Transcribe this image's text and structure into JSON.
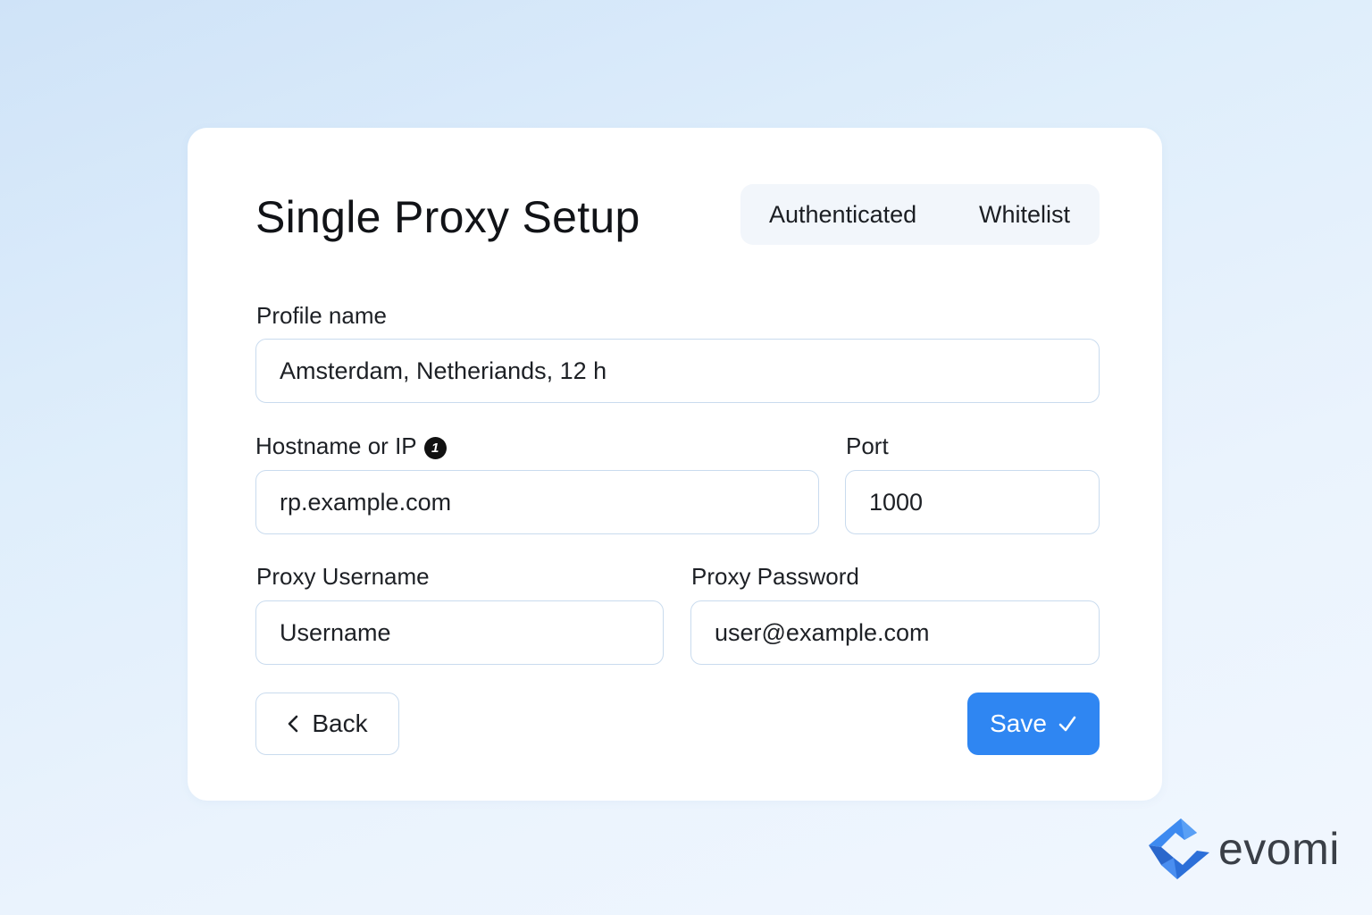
{
  "card": {
    "title": "Single Proxy Setup",
    "toggle": {
      "options": [
        "Authenticated",
        "Whitelist"
      ]
    },
    "fields": {
      "profile_name": {
        "label": "Profile name",
        "value": "Amsterdam, Netheriands, 12 h"
      },
      "hostname": {
        "label": "Hostname or IP",
        "value": "rp.example.com",
        "info_badge": "1"
      },
      "port": {
        "label": "Port",
        "value": "1000"
      },
      "username": {
        "label": "Proxy Username",
        "placeholder": "Username"
      },
      "password": {
        "label": "Proxy Password",
        "value": "user@example.com"
      }
    },
    "buttons": {
      "back": {
        "label": "Back",
        "icon": "chevron-left-icon"
      },
      "save": {
        "label": "Save",
        "icon": "checkmark-icon"
      }
    }
  },
  "brand": {
    "name": "evomi",
    "logo": "evomi-logo-icon"
  },
  "colors": {
    "accent": "#2f86f2",
    "field_border": "#c9dbee",
    "toggle_bg": "#f2f6fb"
  }
}
